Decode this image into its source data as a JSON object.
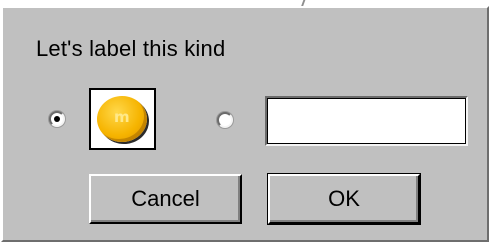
{
  "dialog": {
    "prompt": "Let's label this kind",
    "options": [
      {
        "type": "image",
        "selected": true,
        "image_icon": "yellow-candy-icon",
        "candy_mark": "m"
      },
      {
        "type": "text",
        "selected": false,
        "value": ""
      }
    ],
    "buttons": {
      "cancel_label": "Cancel",
      "ok_label": "OK"
    }
  },
  "colors": {
    "dialog_background": "#c0c0c0",
    "candy": "#f6b400"
  }
}
